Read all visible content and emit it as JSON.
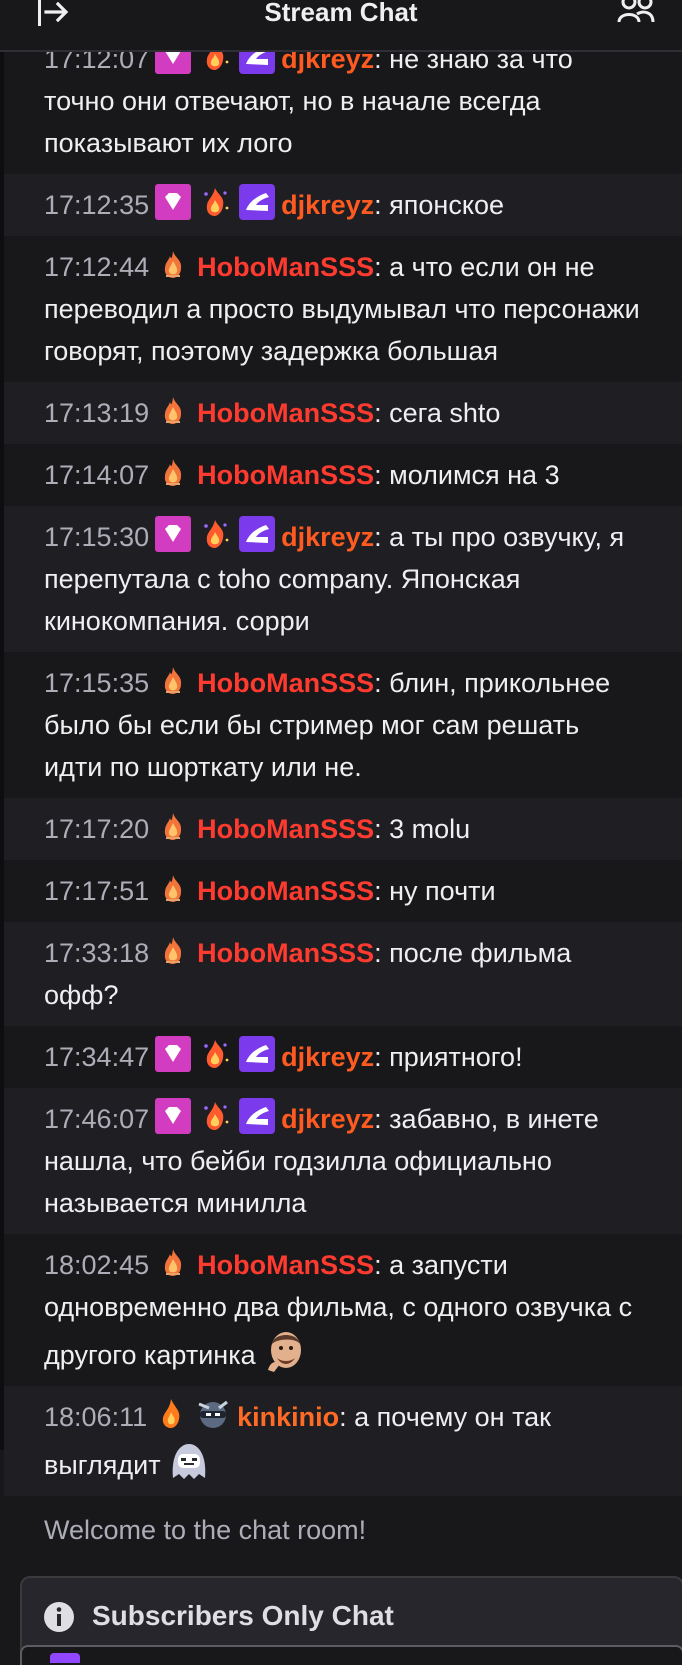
{
  "header": {
    "title": "Stream Chat"
  },
  "colors": {
    "hobo": "#ff3b30",
    "djkreyz": "#ff5a1f",
    "kinkinio": "#ff6a24",
    "timestamp": "#adadb8"
  },
  "messages": [
    {
      "time": "17:12:07",
      "user": "djkreyz",
      "text": ": не знаю за что точно они отвечают, но в начале всегда показывают их лого",
      "badges": [
        "gem-badge",
        "fire-badge",
        "shoe-badge"
      ]
    },
    {
      "time": "17:12:35",
      "user": "djkreyz",
      "text": ": японское",
      "badges": [
        "gem-badge",
        "fire-badge",
        "shoe-badge"
      ]
    },
    {
      "time": "17:12:44",
      "user": "HoboManSSS",
      "text": ": а что если он не переводил а просто выдумывал что персонажи говорят, поэтому задержка большая",
      "badges": [
        "flame-badge"
      ]
    },
    {
      "time": "17:13:19",
      "user": "HoboManSSS",
      "text": ": сега shto",
      "badges": [
        "flame-badge"
      ]
    },
    {
      "time": "17:14:07",
      "user": "HoboManSSS",
      "text": ": молимся на 3",
      "badges": [
        "flame-badge"
      ]
    },
    {
      "time": "17:15:30",
      "user": "djkreyz",
      "text": ": а ты про озвучку, я перепутала с toho company. Японская кинокомпания. сорри",
      "badges": [
        "gem-badge",
        "fire-badge",
        "shoe-badge"
      ]
    },
    {
      "time": "17:15:35",
      "user": "HoboManSSS",
      "text": ": блин, прикольнее было бы если бы стример мог сам решать идти по шорткату или не.",
      "badges": [
        "flame-badge"
      ]
    },
    {
      "time": "17:17:20",
      "user": "HoboManSSS",
      "text": ": 3 molu",
      "badges": [
        "flame-badge"
      ]
    },
    {
      "time": "17:17:51",
      "user": "HoboManSSS",
      "text": ": ну почти",
      "badges": [
        "flame-badge"
      ]
    },
    {
      "time": "17:33:18",
      "user": "HoboManSSS",
      "text": ": после фильма офф?",
      "badges": [
        "flame-badge"
      ]
    },
    {
      "time": "17:34:47",
      "user": "djkreyz",
      "text": ": приятного!",
      "badges": [
        "gem-badge",
        "fire-badge",
        "shoe-badge"
      ]
    },
    {
      "time": "17:46:07",
      "user": "djkreyz",
      "text": ": забавно, в инете нашла, что бейби годзилла официально называется минилла",
      "badges": [
        "gem-badge",
        "fire-badge",
        "shoe-badge"
      ]
    },
    {
      "time": "18:02:45",
      "user": "HoboManSSS",
      "text": ": а запусти одновременно два фильма, с одного озвучка с другого картинка",
      "badges": [
        "flame-badge"
      ],
      "emote": "face-emote"
    },
    {
      "time": "18:06:11",
      "user": "kinkinio",
      "text": ": а почему он так выглядит",
      "badges": [
        "orange-flame-badge",
        "ninja-badge"
      ],
      "emote": "ghost-emote"
    }
  ],
  "welcome": "Welcome to the chat room!",
  "banner": {
    "text": "Subscribers Only Chat",
    "icon": "info-icon"
  }
}
